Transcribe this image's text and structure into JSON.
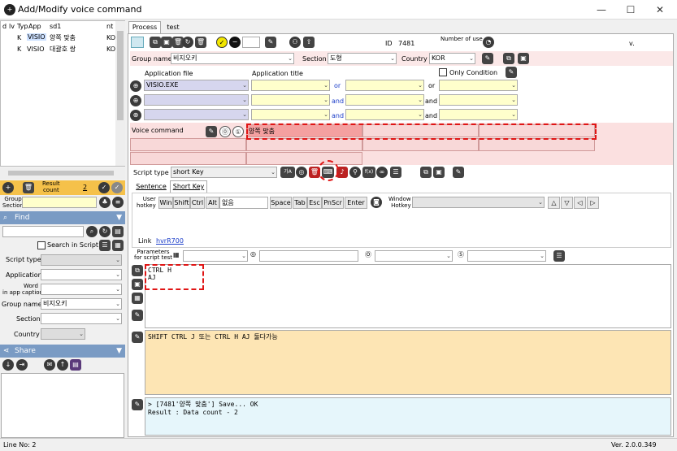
{
  "window": {
    "title": "Add/Modify voice command",
    "minimize": "—",
    "maximize": "☐",
    "close": "✕"
  },
  "grid": {
    "headers": [
      "d",
      "lv",
      "Typ",
      "App",
      "sd1",
      "nt"
    ],
    "rows": [
      {
        "typ": "K",
        "app": "VISIO",
        "sd1": "양쪽 맞춤",
        "nt": "KO"
      },
      {
        "typ": "K",
        "app": "VISIO",
        "sd1": "대괄호 쌍",
        "nt": "KO"
      }
    ]
  },
  "left": {
    "result_label": "Result\ncount",
    "result_count": "2",
    "group_section_label": "Group\nSection",
    "find_title": "Find",
    "search_in_script": "Search in Script",
    "filters": {
      "script_type": "Script type",
      "application": "Application",
      "word_label": "Word\nin app caption",
      "group_name": "Group name",
      "group_name_value": "비지오키",
      "section": "Section",
      "country": "Country"
    },
    "share_title": "Share"
  },
  "tabs": {
    "process": "Process",
    "test": "test"
  },
  "top": {
    "id_label": "ID",
    "id_value": "7481",
    "number_of_use": "Number of use",
    "v_mark": "v.",
    "group_name_label": "Group name",
    "group_name_value": "비지오키",
    "section_label": "Section",
    "section_value": "도형",
    "country_label": "Country",
    "country_value": "KOR"
  },
  "app": {
    "app_file_label": "Application file",
    "app_title_label": "Application title",
    "only_condition": "Only Condition",
    "rows": [
      {
        "file": "VISIO.EXE",
        "conj1": "or",
        "conj2": "or"
      },
      {
        "file": "",
        "conj1": "and",
        "conj2": "and"
      },
      {
        "file": "",
        "conj1": "and",
        "conj2": "and"
      }
    ]
  },
  "voice": {
    "label": "Voice command",
    "cmd1": "양쪽 맞춤"
  },
  "script": {
    "type_label": "Script type",
    "type_value": "short Key"
  },
  "subtabs": {
    "sentence": "Sentence",
    "shortkey": "Short Key"
  },
  "hotkey": {
    "user_label": "User\nhotkey",
    "keys": [
      "Win",
      "Shift",
      "Ctrl",
      "Alt"
    ],
    "value": "없음",
    "keys2": [
      "Space",
      "Tab",
      "Esc",
      "PnScr",
      "Enter"
    ],
    "window_label": "Window\nHotkey",
    "arrows": [
      "△",
      "▽",
      "◁",
      "▷"
    ]
  },
  "link": {
    "label": "Link",
    "value": "hvrR700"
  },
  "params": {
    "label": "Parameters\nfor script test"
  },
  "editor": {
    "line1": "CTRL H",
    "line2": "AJ"
  },
  "comment": {
    "text": "SHIFT CTRL J 또는 CTRL H AJ 둘다가능"
  },
  "log": {
    "line1": "> [7481'양쪽 맞춤'] Save... OK",
    "line2": "Result : Data count - 2"
  },
  "status": {
    "line": "Line No: 2",
    "version": "Ver. 2.0.0.349"
  }
}
